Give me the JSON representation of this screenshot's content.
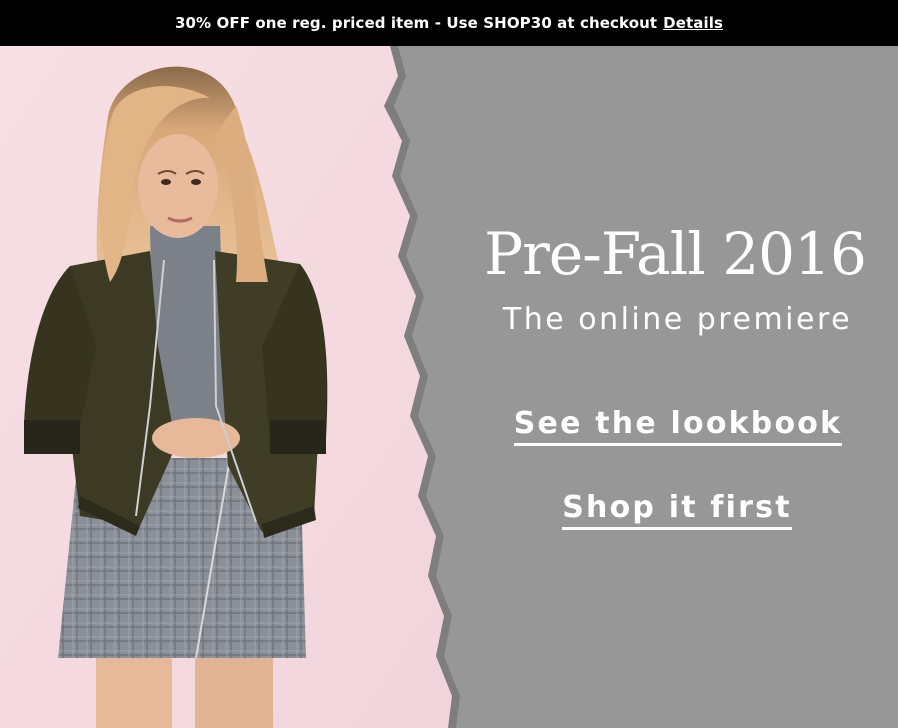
{
  "promo": {
    "text": "30% OFF one reg. priced item - Use SHOP30 at checkout",
    "details_label": "Details"
  },
  "hero": {
    "headline": "Pre-Fall 2016",
    "subheadline": "The online premiere",
    "cta_lookbook": "See the lookbook",
    "cta_shop": "Shop it first"
  },
  "colors": {
    "promo_bg": "#000000",
    "panel_gray": "#979797",
    "photo_bg": "#f6dce2",
    "text": "#ffffff"
  }
}
